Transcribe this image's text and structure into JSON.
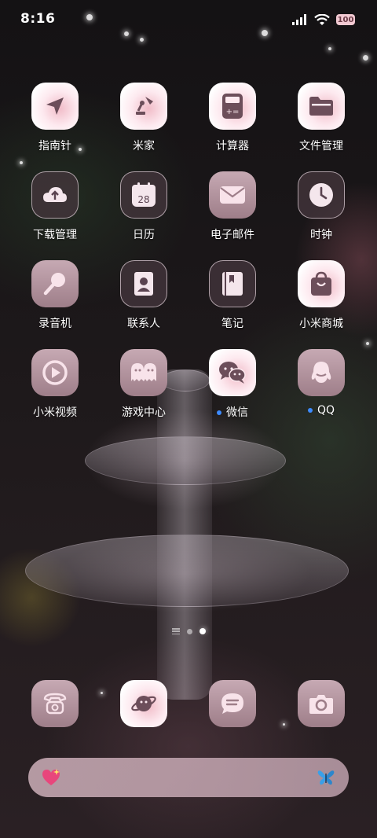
{
  "status_bar": {
    "time": "8:16",
    "battery": "100"
  },
  "apps": [
    {
      "label": "指南针",
      "icon": "compass-arrow-icon",
      "dot": false
    },
    {
      "label": "米家",
      "icon": "lamp-icon",
      "dot": false
    },
    {
      "label": "计算器",
      "icon": "calculator-icon",
      "dot": false
    },
    {
      "label": "文件管理",
      "icon": "folder-icon",
      "dot": false
    },
    {
      "label": "下载管理",
      "icon": "cloud-download-icon",
      "dot": false
    },
    {
      "label": "日历",
      "icon": "calendar-icon",
      "date": "28",
      "dot": false
    },
    {
      "label": "电子邮件",
      "icon": "envelope-icon",
      "dot": false
    },
    {
      "label": "时钟",
      "icon": "clock-icon",
      "dot": false
    },
    {
      "label": "录音机",
      "icon": "microphone-icon",
      "dot": false
    },
    {
      "label": "联系人",
      "icon": "contact-card-icon",
      "dot": false
    },
    {
      "label": "笔记",
      "icon": "notebook-icon",
      "dot": false
    },
    {
      "label": "小米商城",
      "icon": "shopping-bag-icon",
      "dot": false
    },
    {
      "label": "小米视频",
      "icon": "play-icon",
      "dot": false
    },
    {
      "label": "游戏中心",
      "icon": "ghosts-icon",
      "dot": false
    },
    {
      "label": "微信",
      "icon": "wechat-icon",
      "dot": true
    },
    {
      "label": "QQ",
      "icon": "qq-penguin-icon",
      "dot": true
    }
  ],
  "dock": [
    {
      "icon": "telephone-icon"
    },
    {
      "icon": "planet-icon"
    },
    {
      "icon": "message-bubble-icon"
    },
    {
      "icon": "camera-icon"
    }
  ],
  "page_indicator": {
    "pages": 2,
    "current": 2
  },
  "search_bar": {
    "left_icon": "sparkling-heart-icon",
    "right_icon": "butterfly-icon"
  },
  "colors": {
    "accent": "#f1bcc8",
    "mauve": "#9e7e89",
    "notification_dot": "#3d8bff"
  }
}
